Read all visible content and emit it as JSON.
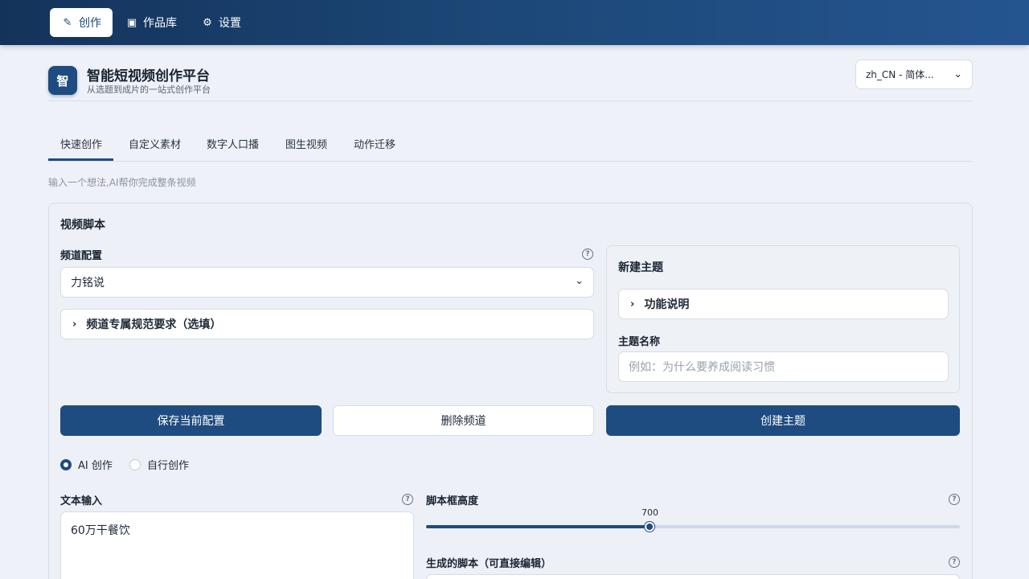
{
  "nav": {
    "create": "创作",
    "library": "作品库",
    "settings": "设置"
  },
  "header": {
    "logo_char": "智",
    "title": "智能短视频创作平台",
    "subtitle": "从选题到成片的一站式创作平台",
    "language": "zh_CN - 简体..."
  },
  "tabs": [
    "快速创作",
    "自定义素材",
    "数字人口播",
    "图生视频",
    "动作迁移"
  ],
  "hint": "输入一个想法,AI帮你完成整条视频",
  "script_card": {
    "title": "视频脚本",
    "channel_label": "频道配置",
    "channel_value": "力铭说",
    "channel_rules": "频道专属规范要求（选填）",
    "new_topic": {
      "title": "新建主题",
      "feature_desc": "功能说明",
      "topic_name_label": "主题名称",
      "topic_name_placeholder": "例如：为什么要养成阅读习惯"
    },
    "buttons": {
      "save": "保存当前配置",
      "delete": "删除频道",
      "create_topic": "创建主题"
    },
    "mode": {
      "ai": "AI 创作",
      "manual": "自行创作",
      "selected": "ai"
    },
    "text_input_label": "文本输入",
    "text_input_value": "60万干餐饮",
    "script_height_label": "脚本框高度",
    "script_height_value": "700",
    "script_height_fraction": 0.419,
    "generated_script_label": "生成的脚本（可直接编辑）"
  },
  "colors": {
    "primary": "#1f4c80",
    "nav_bg": "#1c4878",
    "page_bg": "#eef2f8"
  }
}
